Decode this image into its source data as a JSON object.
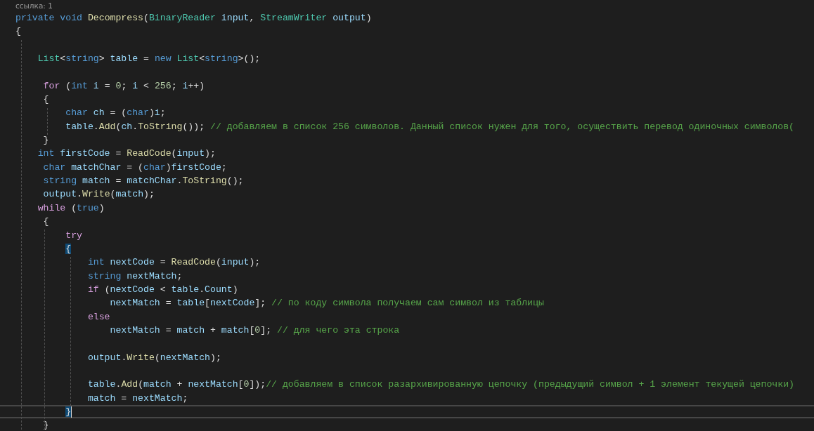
{
  "codelens": "ссылка: 1",
  "lines": [
    {
      "current": false,
      "tokens": [
        {
          "kind": "kw",
          "text": "private void "
        },
        {
          "kind": "fn",
          "text": "Decompress"
        },
        {
          "kind": "p",
          "text": "("
        },
        {
          "kind": "type",
          "text": "BinaryReader "
        },
        {
          "kind": "var",
          "text": "input"
        },
        {
          "kind": "p",
          "text": ", "
        },
        {
          "kind": "type",
          "text": "StreamWriter "
        },
        {
          "kind": "var",
          "text": "output"
        },
        {
          "kind": "p",
          "text": ")"
        }
      ]
    },
    {
      "current": false,
      "tokens": [
        {
          "kind": "p",
          "text": "{"
        }
      ]
    },
    {
      "current": false
    },
    {
      "current": false,
      "tokens": [
        {
          "kind": "type",
          "text": "    List"
        },
        {
          "kind": "p",
          "text": "<"
        },
        {
          "kind": "kw",
          "text": "string"
        },
        {
          "kind": "p",
          "text": "> "
        },
        {
          "kind": "var",
          "text": "table"
        },
        {
          "kind": "p",
          "text": " = "
        },
        {
          "kind": "kw",
          "text": "new "
        },
        {
          "kind": "type",
          "text": "List"
        },
        {
          "kind": "p",
          "text": "<"
        },
        {
          "kind": "kw",
          "text": "string"
        },
        {
          "kind": "p",
          "text": ">();"
        }
      ]
    },
    {
      "current": false
    },
    {
      "current": false,
      "tokens": [
        {
          "kind": "ctl",
          "text": "     for"
        },
        {
          "kind": "p",
          "text": " ("
        },
        {
          "kind": "kw",
          "text": "int "
        },
        {
          "kind": "var",
          "text": "i"
        },
        {
          "kind": "p",
          "text": " = "
        },
        {
          "kind": "num",
          "text": "0"
        },
        {
          "kind": "p",
          "text": "; "
        },
        {
          "kind": "var",
          "text": "i"
        },
        {
          "kind": "p",
          "text": " < "
        },
        {
          "kind": "num",
          "text": "256"
        },
        {
          "kind": "p",
          "text": "; "
        },
        {
          "kind": "var",
          "text": "i"
        },
        {
          "kind": "p",
          "text": "++)"
        }
      ]
    },
    {
      "current": false,
      "tokens": [
        {
          "kind": "p",
          "text": "     {"
        }
      ]
    },
    {
      "current": false,
      "tokens": [
        {
          "kind": "kw",
          "text": "         char "
        },
        {
          "kind": "var",
          "text": "ch"
        },
        {
          "kind": "p",
          "text": " = ("
        },
        {
          "kind": "kw",
          "text": "char"
        },
        {
          "kind": "p",
          "text": ")"
        },
        {
          "kind": "var",
          "text": "i"
        },
        {
          "kind": "p",
          "text": ";"
        }
      ]
    },
    {
      "current": false,
      "tokens": [
        {
          "kind": "var",
          "text": "         table"
        },
        {
          "kind": "p",
          "text": "."
        },
        {
          "kind": "fn",
          "text": "Add"
        },
        {
          "kind": "p",
          "text": "("
        },
        {
          "kind": "var",
          "text": "ch"
        },
        {
          "kind": "p",
          "text": "."
        },
        {
          "kind": "fn",
          "text": "ToString"
        },
        {
          "kind": "p",
          "text": "()); "
        },
        {
          "kind": "cmt",
          "text": "// добавляем в список 256 символов. Данный список нужен для того, осуществить перевод одиночных символов("
        }
      ]
    },
    {
      "current": false,
      "tokens": [
        {
          "kind": "p",
          "text": "     }"
        }
      ]
    },
    {
      "current": false,
      "tokens": [
        {
          "kind": "kw",
          "text": "    int "
        },
        {
          "kind": "var",
          "text": "firstCode"
        },
        {
          "kind": "p",
          "text": " = "
        },
        {
          "kind": "fn",
          "text": "ReadCode"
        },
        {
          "kind": "p",
          "text": "("
        },
        {
          "kind": "var",
          "text": "input"
        },
        {
          "kind": "p",
          "text": ");"
        }
      ]
    },
    {
      "current": false,
      "tokens": [
        {
          "kind": "kw",
          "text": "     char "
        },
        {
          "kind": "var",
          "text": "matchChar"
        },
        {
          "kind": "p",
          "text": " = ("
        },
        {
          "kind": "kw",
          "text": "char"
        },
        {
          "kind": "p",
          "text": ")"
        },
        {
          "kind": "var",
          "text": "firstCode"
        },
        {
          "kind": "p",
          "text": ";"
        }
      ]
    },
    {
      "current": false,
      "tokens": [
        {
          "kind": "kw",
          "text": "     string "
        },
        {
          "kind": "var",
          "text": "match"
        },
        {
          "kind": "p",
          "text": " = "
        },
        {
          "kind": "var",
          "text": "matchChar"
        },
        {
          "kind": "p",
          "text": "."
        },
        {
          "kind": "fn",
          "text": "ToString"
        },
        {
          "kind": "p",
          "text": "();"
        }
      ]
    },
    {
      "current": false,
      "tokens": [
        {
          "kind": "var",
          "text": "     output"
        },
        {
          "kind": "p",
          "text": "."
        },
        {
          "kind": "fn",
          "text": "Write"
        },
        {
          "kind": "p",
          "text": "("
        },
        {
          "kind": "var",
          "text": "match"
        },
        {
          "kind": "p",
          "text": ");"
        }
      ]
    },
    {
      "current": false,
      "tokens": [
        {
          "kind": "ctl",
          "text": "    while"
        },
        {
          "kind": "p",
          "text": " ("
        },
        {
          "kind": "kw",
          "text": "true"
        },
        {
          "kind": "p",
          "text": ")"
        }
      ]
    },
    {
      "current": false,
      "tokens": [
        {
          "kind": "p",
          "text": "     {"
        }
      ]
    },
    {
      "current": false,
      "tokens": [
        {
          "kind": "ctl",
          "text": "         try"
        }
      ]
    },
    {
      "current": false,
      "tokens": [
        {
          "kind": "brace",
          "text": "{"
        }
      ]
    },
    {
      "current": false,
      "tokens": [
        {
          "kind": "kw",
          "text": "             int "
        },
        {
          "kind": "var",
          "text": "nextCode"
        },
        {
          "kind": "p",
          "text": " = "
        },
        {
          "kind": "fn",
          "text": "ReadCode"
        },
        {
          "kind": "p",
          "text": "("
        },
        {
          "kind": "var",
          "text": "input"
        },
        {
          "kind": "p",
          "text": ");"
        }
      ]
    },
    {
      "current": false,
      "tokens": [
        {
          "kind": "kw",
          "text": "             string "
        },
        {
          "kind": "var",
          "text": "nextMatch"
        },
        {
          "kind": "p",
          "text": ";"
        }
      ]
    },
    {
      "current": false,
      "tokens": [
        {
          "kind": "ctl",
          "text": "             if"
        },
        {
          "kind": "p",
          "text": " ("
        },
        {
          "kind": "var",
          "text": "nextCode"
        },
        {
          "kind": "p",
          "text": " < "
        },
        {
          "kind": "var",
          "text": "table"
        },
        {
          "kind": "p",
          "text": "."
        },
        {
          "kind": "var",
          "text": "Count"
        },
        {
          "kind": "p",
          "text": ")"
        }
      ]
    },
    {
      "current": false,
      "tokens": [
        {
          "kind": "var",
          "text": "                 nextMatch"
        },
        {
          "kind": "p",
          "text": " = "
        },
        {
          "kind": "var",
          "text": "table"
        },
        {
          "kind": "p",
          "text": "["
        },
        {
          "kind": "var",
          "text": "nextCode"
        },
        {
          "kind": "p",
          "text": "]; "
        },
        {
          "kind": "cmt",
          "text": "// по коду символа получаем сам символ из таблицы"
        }
      ]
    },
    {
      "current": false,
      "tokens": [
        {
          "kind": "ctl",
          "text": "             else"
        }
      ]
    },
    {
      "current": false,
      "tokens": [
        {
          "kind": "var",
          "text": "                 nextMatch"
        },
        {
          "kind": "p",
          "text": " = "
        },
        {
          "kind": "var",
          "text": "match"
        },
        {
          "kind": "p",
          "text": " + "
        },
        {
          "kind": "var",
          "text": "match"
        },
        {
          "kind": "p",
          "text": "["
        },
        {
          "kind": "num",
          "text": "0"
        },
        {
          "kind": "p",
          "text": "]; "
        },
        {
          "kind": "cmt",
          "text": "// для чего эта строка"
        }
      ]
    },
    {
      "current": false
    },
    {
      "current": false,
      "tokens": [
        {
          "kind": "var",
          "text": "             output"
        },
        {
          "kind": "p",
          "text": "."
        },
        {
          "kind": "fn",
          "text": "Write"
        },
        {
          "kind": "p",
          "text": "("
        },
        {
          "kind": "var",
          "text": "nextMatch"
        },
        {
          "kind": "p",
          "text": ");"
        }
      ]
    },
    {
      "current": false
    },
    {
      "current": false,
      "tokens": [
        {
          "kind": "var",
          "text": "             table"
        },
        {
          "kind": "p",
          "text": "."
        },
        {
          "kind": "fn",
          "text": "Add"
        },
        {
          "kind": "p",
          "text": "("
        },
        {
          "kind": "var",
          "text": "match"
        },
        {
          "kind": "p",
          "text": " + "
        },
        {
          "kind": "var",
          "text": "nextMatch"
        },
        {
          "kind": "p",
          "text": "["
        },
        {
          "kind": "num",
          "text": "0"
        },
        {
          "kind": "p",
          "text": "]);"
        },
        {
          "kind": "cmt",
          "text": "// добавляем в список разархивированную цепочку (предыдущий символ + 1 элемент текущей цепочки)"
        }
      ]
    },
    {
      "current": false,
      "tokens": [
        {
          "kind": "var",
          "text": "             match"
        },
        {
          "kind": "p",
          "text": " = "
        },
        {
          "kind": "var",
          "text": "nextMatch"
        },
        {
          "kind": "p",
          "text": ";"
        }
      ]
    },
    {
      "current": true,
      "tokens": [
        {
          "kind": "brace",
          "text": "}"
        }
      ]
    },
    {
      "current": false,
      "tokens": [
        {
          "kind": "p",
          "text": "     }"
        }
      ]
    }
  ]
}
